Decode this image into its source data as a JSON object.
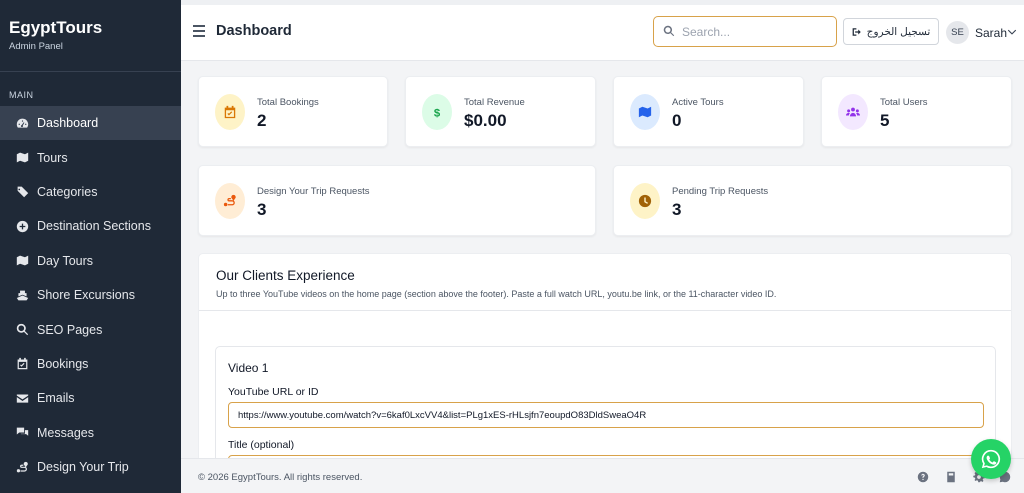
{
  "brand": {
    "title": "EgyptTours",
    "subtitle": "Admin Panel"
  },
  "sidebar": {
    "section_label": "MAIN",
    "items": [
      {
        "label": "Dashboard",
        "icon": "gauge-icon",
        "active": true
      },
      {
        "label": "Tours",
        "icon": "map-icon"
      },
      {
        "label": "Categories",
        "icon": "tags-icon"
      },
      {
        "label": "Destination Sections",
        "icon": "plus-circle-icon"
      },
      {
        "label": "Day Tours",
        "icon": "map-icon"
      },
      {
        "label": "Shore Excursions",
        "icon": "ship-icon"
      },
      {
        "label": "SEO Pages",
        "icon": "search-icon"
      },
      {
        "label": "Bookings",
        "icon": "calendar-check-icon"
      },
      {
        "label": "Emails",
        "icon": "envelope-icon"
      },
      {
        "label": "Messages",
        "icon": "comments-icon"
      },
      {
        "label": "Design Your Trip",
        "icon": "route-icon"
      }
    ]
  },
  "header": {
    "title": "Dashboard",
    "search_placeholder": "Search...",
    "logout_label": "تسجيل الخروج",
    "user_initials": "SE",
    "user_name": "Sarah"
  },
  "stats": [
    {
      "label": "Total Bookings",
      "value": "2",
      "icon": "calendar-check-icon",
      "color": "#d97706",
      "bg": "#fef3c7"
    },
    {
      "label": "Total Revenue",
      "value": "$0.00",
      "icon": "dollar-icon",
      "color": "#16a34a",
      "bg": "#dcfce7"
    },
    {
      "label": "Active Tours",
      "value": "0",
      "icon": "map-icon",
      "color": "#2563eb",
      "bg": "#dbeafe"
    },
    {
      "label": "Total Users",
      "value": "5",
      "icon": "users-icon",
      "color": "#9333ea",
      "bg": "#f3e8ff"
    },
    {
      "label": "Design Your Trip Requests",
      "value": "3",
      "icon": "route-icon",
      "color": "#ea580c",
      "bg": "#ffedd5"
    },
    {
      "label": "Pending Trip Requests",
      "value": "3",
      "icon": "clock-icon",
      "color": "#a16207",
      "bg": "#fef3c7"
    }
  ],
  "clients": {
    "title": "Our Clients Experience",
    "description": "Up to three YouTube videos on the home page (section above the footer). Paste a full watch URL, youtu.be link, or the 11-character video ID.",
    "video_title": "Video 1",
    "url_label": "YouTube URL or ID",
    "url_value": "https://www.youtube.com/watch?v=6kaf0LxcVV4&list=PLg1xES-rHLsjfn7eoupdO83DldSweaO4R",
    "title_label": "Title (optional)"
  },
  "footer": {
    "copyright": "© 2026 EgyptTours. All rights reserved."
  },
  "accent_color": "#d8a24a",
  "whatsapp_color": "#25d366"
}
